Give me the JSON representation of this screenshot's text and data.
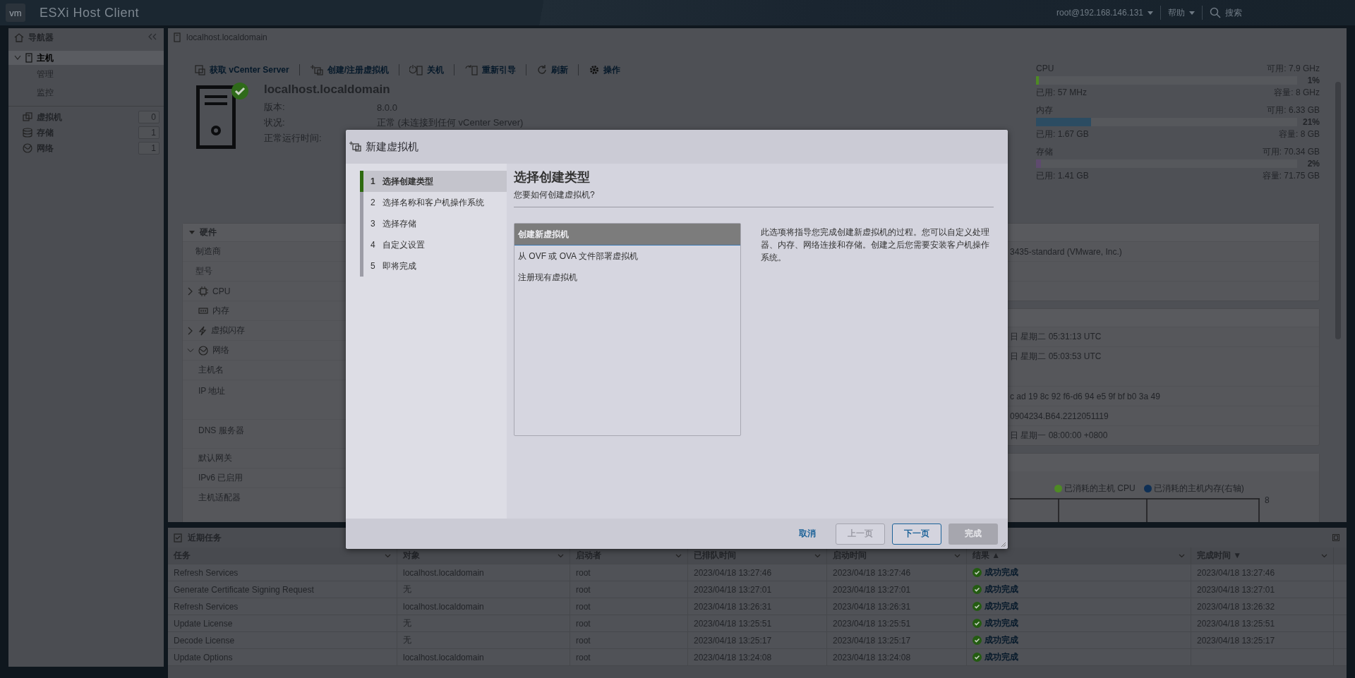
{
  "top_bar": {
    "logo": "vm",
    "product": "ESXi Host Client",
    "user": "root@192.168.146.131",
    "help": "帮助",
    "search": "搜索"
  },
  "navigator": {
    "title": "导航器",
    "tree": [
      {
        "label": "主机",
        "selected": true,
        "expanded": true,
        "children": [
          {
            "label": "管理",
            "selected": false
          },
          {
            "label": "监控",
            "selected": false
          }
        ]
      }
    ],
    "inventory": [
      {
        "label": "虚拟机",
        "count": "0",
        "kind": "vm"
      },
      {
        "label": "存储",
        "count": "1",
        "kind": "storage"
      },
      {
        "label": "网络",
        "count": "1",
        "kind": "network"
      }
    ]
  },
  "host": {
    "breadcrumb": "localhost.localdomain",
    "toolbar": [
      {
        "label": "获取 vCenter Server",
        "kind": "vcenter"
      },
      {
        "label": "创建/注册虚拟机",
        "kind": "create"
      },
      {
        "label": "关机",
        "kind": "power"
      },
      {
        "label": "重新引导",
        "kind": "reboot"
      },
      {
        "label": "刷新",
        "kind": "refresh"
      },
      {
        "label": "操作",
        "kind": "actions"
      }
    ],
    "name": "localhost.localdomain",
    "healthy": true,
    "properties": [
      {
        "label": "版本:",
        "value": "8.0.0"
      },
      {
        "label": "状况:",
        "value": "正常 (未连接到任何 vCenter Server)"
      },
      {
        "label": "正常运行时间:"
      }
    ]
  },
  "resources": [
    {
      "name": "CPU",
      "free": "可用: 7.9 GHz",
      "level": 0.01,
      "percent": "1%",
      "used": "已用: 57 MHz",
      "capacity": "容量: 8 GHz",
      "color": "#4e8a24"
    },
    {
      "name": "内存",
      "free": "可用: 6.33 GB",
      "level": 0.21,
      "percent": "21%",
      "used": "已用: 1.67 GB",
      "capacity": "容量: 8 GB",
      "color": "#2c4c62"
    },
    {
      "name": "存储",
      "free": "可用: 70.34 GB",
      "level": 0.02,
      "percent": "2%",
      "used": "已用: 1.41 GB",
      "capacity": "容量: 71.75 GB",
      "color": "#5e4a6e"
    }
  ],
  "hardware": {
    "title": "硬件",
    "expanded": true,
    "rows": [
      {
        "label": "制造商"
      },
      {
        "label": "型号"
      },
      {
        "label": "CPU",
        "kind": "cpu",
        "expanded": false
      },
      {
        "label": "内存",
        "kind": "memory"
      },
      {
        "label": "虚拟闪存",
        "kind": "flash",
        "expanded": false
      },
      {
        "label": "网络",
        "kind": "network",
        "expanded": true,
        "children": [
          {
            "label": "主机名"
          },
          {
            "label": "IP 地址",
            "multiline": true
          },
          {
            "label": "DNS 服务器",
            "multiline": true
          },
          {
            "label": "默认网关"
          },
          {
            "label": "IPv6 已启用"
          },
          {
            "label": "主机适配器"
          }
        ]
      }
    ]
  },
  "config_values": [
    "3435-standard (VMware, Inc.)"
  ],
  "system_values": [
    "日 星期二 05:31:13 UTC",
    "日 星期二 05:03:53 UTC",
    "c ad 19 8c 92 f6-d6 94 e5 9f bf b0 3a 49",
    "0904234.B64.2212051119",
    "日 星期一 08:00:00 +0800"
  ],
  "performance": {
    "legend": [
      {
        "label": "已消耗的主机 CPU",
        "color": "#4e8a24"
      },
      {
        "label": "已消耗的主机内存(右轴)",
        "color": "#0e2f55"
      }
    ],
    "right_axis_label": "8"
  },
  "dialog": {
    "title": "新建虚拟机",
    "steps": [
      {
        "number": "1",
        "label": "选择创建类型",
        "selected": true
      },
      {
        "number": "2",
        "label": "选择名称和客户机操作系统",
        "selected": false
      },
      {
        "number": "3",
        "label": "选择存储",
        "selected": false
      },
      {
        "number": "4",
        "label": "自定义设置",
        "selected": false
      },
      {
        "number": "5",
        "label": "即将完成",
        "selected": false
      }
    ],
    "heading": "选择创建类型",
    "question": "您要如何创建虚拟机?",
    "options": [
      {
        "label": "创建新虚拟机",
        "selected": true
      },
      {
        "label": "从 OVF 或 OVA 文件部署虚拟机",
        "selected": false
      },
      {
        "label": "注册现有虚拟机",
        "selected": false
      }
    ],
    "description": "此选项将指导您完成创建新虚拟机的过程。您可以自定义处理器、内存、网络连接和存储。创建之后您需要安装客户机操作系统。",
    "buttons": [
      {
        "label": "取消",
        "kind": "link",
        "disabled": false
      },
      {
        "label": "上一页",
        "kind": "secondary",
        "disabled": true
      },
      {
        "label": "下一页",
        "kind": "secondary",
        "disabled": false
      },
      {
        "label": "完成",
        "kind": "primary",
        "disabled": true
      }
    ]
  },
  "tasks": {
    "title": "近期任务",
    "columns": [
      "任务",
      "对象",
      "启动者",
      "已排队时间",
      "启动时间",
      "结果 ▲",
      "完成时间 ▼"
    ],
    "rows": [
      {
        "task": "Refresh Services",
        "target": "localhost.localdomain",
        "initiator": "root",
        "queued": "2023/04/18 13:27:46",
        "started": "2023/04/18 13:27:46",
        "result": "成功完成",
        "completed": "2023/04/18 13:27:46"
      },
      {
        "task": "Generate Certificate Signing Request",
        "target": "无",
        "initiator": "root",
        "queued": "2023/04/18 13:27:01",
        "started": "2023/04/18 13:27:01",
        "result": "成功完成",
        "completed": "2023/04/18 13:27:01"
      },
      {
        "task": "Refresh Services",
        "target": "localhost.localdomain",
        "initiator": "root",
        "queued": "2023/04/18 13:26:31",
        "started": "2023/04/18 13:26:31",
        "result": "成功完成",
        "completed": "2023/04/18 13:26:32"
      },
      {
        "task": "Update License",
        "target": "无",
        "initiator": "root",
        "queued": "2023/04/18 13:25:51",
        "started": "2023/04/18 13:25:51",
        "result": "成功完成",
        "completed": "2023/04/18 13:25:51"
      },
      {
        "task": "Decode License",
        "target": "无",
        "initiator": "root",
        "queued": "2023/04/18 13:25:17",
        "started": "2023/04/18 13:25:17",
        "result": "成功完成",
        "completed": "2023/04/18 13:25:17"
      },
      {
        "task": "Update Options",
        "target": "localhost.localdomain",
        "initiator": "root",
        "queued": "2023/04/18 13:24:08",
        "started": "2023/04/18 13:24:08",
        "result": "成功完成"
      }
    ]
  }
}
